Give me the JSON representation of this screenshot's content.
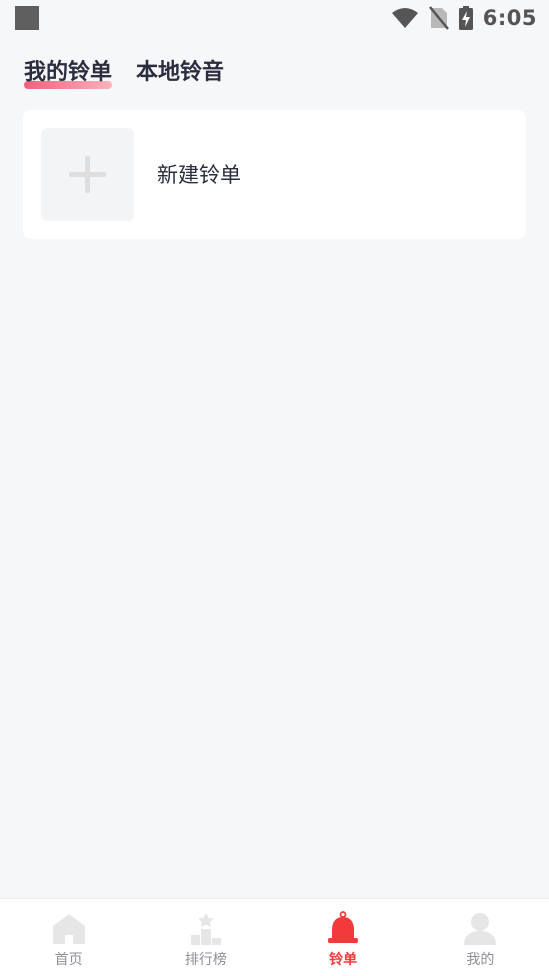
{
  "status_bar": {
    "time": "6:05"
  },
  "tabs": [
    {
      "label": "我的铃单",
      "active": true
    },
    {
      "label": "本地铃音",
      "active": false
    }
  ],
  "new_playlist": {
    "label": "新建铃单"
  },
  "bottom_nav": [
    {
      "label": "首页",
      "icon": "home-icon"
    },
    {
      "label": "排行榜",
      "icon": "ranking-icon"
    },
    {
      "label": "铃单",
      "icon": "bell-icon",
      "active": true
    },
    {
      "label": "我的",
      "icon": "user-icon"
    }
  ],
  "colors": {
    "accent": "#f23a3a",
    "tab_underline_start": "#f0607c",
    "tab_underline_end": "#fbb1bb",
    "background": "#f6f7f9",
    "inactive_icon": "#e6e6e6"
  }
}
